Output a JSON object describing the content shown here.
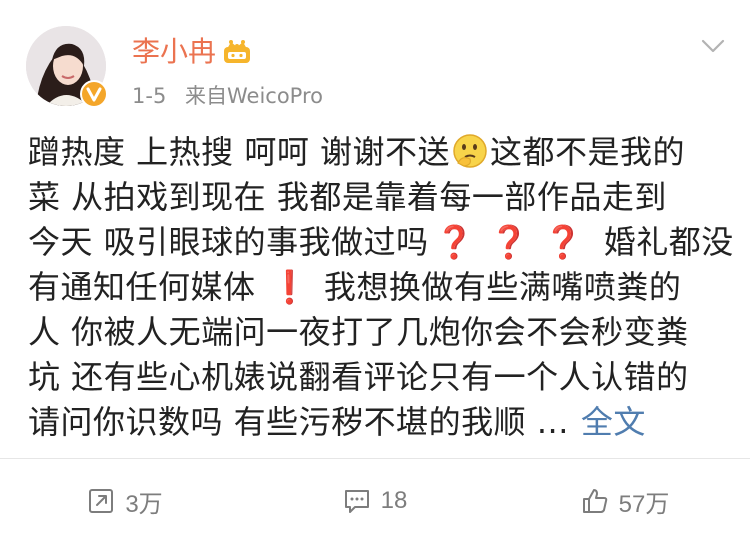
{
  "post": {
    "author": "李小冉",
    "time": "1-5",
    "source": "来自WeicoPro",
    "text_lines": {
      "l1_a": "蹭热度 上热搜 呵呵 谢谢不送",
      "l1_b": "这都不是我的",
      "l2": "菜 从拍戏到现在 我都是靠着每一部作品走到",
      "l3_a": "今天 吸引眼球的事我做过吗",
      "l3_b": "婚礼都没",
      "l4_a": "有通知任何媒体",
      "l4_b": "我想换做有些满嘴喷粪的",
      "l5": "人 你被人无端问一夜打了几炮你会不会秒变粪",
      "l6": "坑 还有些心机婊说翻看评论只有一个人认错的",
      "l7": "请问你识数吗 有些污秽不堪的我顺 ..."
    },
    "full_text_label": "全文",
    "question_mark": "❓",
    "exclamation_mark": "❗"
  },
  "actions": {
    "repost_count": "3万",
    "comment_count": "18",
    "like_count": "57万"
  },
  "icons": {
    "avatar": "avatar-photo",
    "verified": "verified-v-icon",
    "member": "crown-badge-icon",
    "menu": "chevron-down-icon",
    "emoji": "thinking-face-emoji",
    "repost": "repost-icon",
    "comment": "comment-icon",
    "like": "thumbs-up-icon"
  },
  "colors": {
    "name": "#eb7350",
    "meta": "#8c8c8c",
    "link": "#507daf",
    "emphasis": "#d6262a",
    "action": "#7d7d7d"
  }
}
